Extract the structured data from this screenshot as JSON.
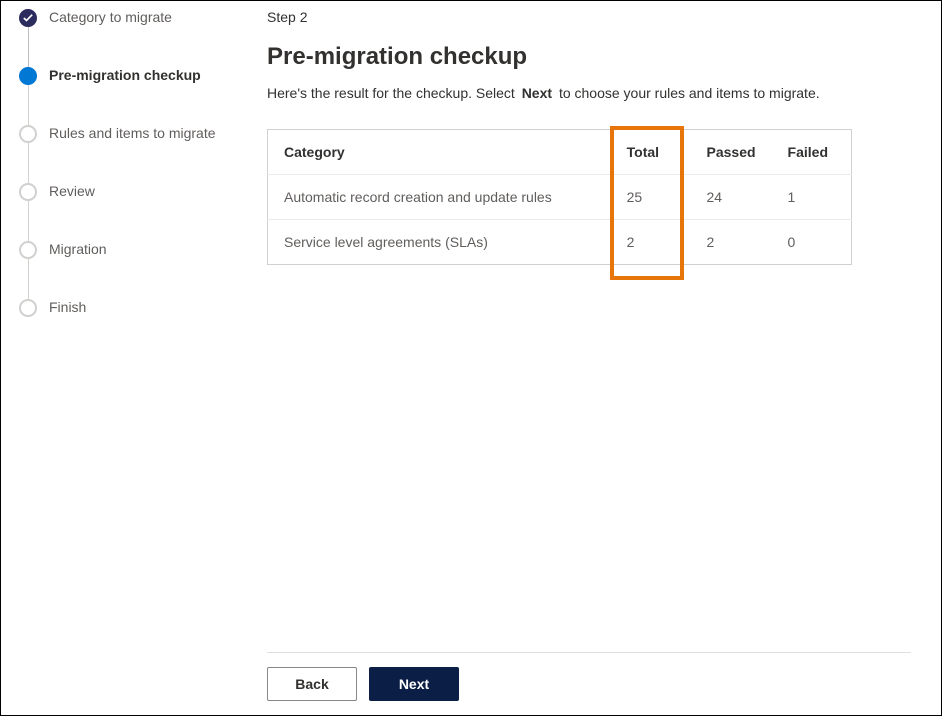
{
  "sidebar": {
    "steps": [
      {
        "label": "Category to migrate",
        "state": "completed"
      },
      {
        "label": "Pre-migration checkup",
        "state": "current"
      },
      {
        "label": "Rules and items to migrate",
        "state": "pending"
      },
      {
        "label": "Review",
        "state": "pending"
      },
      {
        "label": "Migration",
        "state": "pending"
      },
      {
        "label": "Finish",
        "state": "pending"
      }
    ]
  },
  "main": {
    "step_indicator": "Step 2",
    "title": "Pre-migration checkup",
    "description_before": "Here's the result for the checkup. Select",
    "description_strong": "Next",
    "description_after": "to choose your rules and items to migrate."
  },
  "table": {
    "headers": {
      "category": "Category",
      "total": "Total",
      "passed": "Passed",
      "failed": "Failed"
    },
    "rows": [
      {
        "category": "Automatic record creation and update rules",
        "total": "25",
        "passed": "24",
        "failed": "1"
      },
      {
        "category": "Service level agreements (SLAs)",
        "total": "2",
        "passed": "2",
        "failed": "0"
      }
    ]
  },
  "footer": {
    "back_label": "Back",
    "next_label": "Next"
  }
}
